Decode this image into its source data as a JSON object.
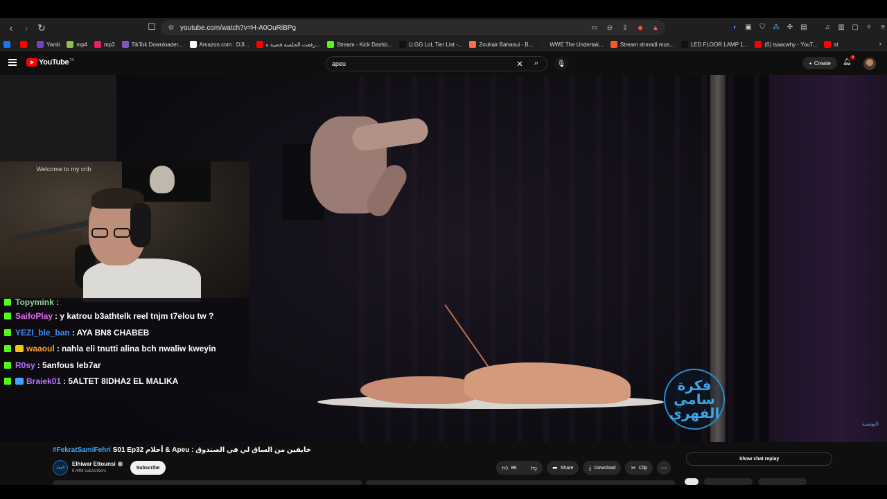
{
  "browser": {
    "url": "youtube.com/watch?v=H-A0OuRiBPg",
    "bookmarks": [
      {
        "label": "",
        "color": "#1877f2"
      },
      {
        "label": "",
        "color": "#ff0000"
      },
      {
        "label": "Yamli",
        "color": "#7b3fc4"
      },
      {
        "label": "mp4",
        "color": "#8bc34a"
      },
      {
        "label": "mp3",
        "color": "#e91e63"
      },
      {
        "label": "TikTok Downloader...",
        "color": "#7e57c2"
      },
      {
        "label": "Amazon.com : DJI...",
        "color": "#ffffff"
      },
      {
        "label": "رفعت الجلسة فضية ه...",
        "color": "#ff0000"
      },
      {
        "label": "Stream - Kick Dashb...",
        "color": "#53fc18"
      },
      {
        "label": "U.GG LoL Tier List -...",
        "color": "#111111"
      },
      {
        "label": "Zouhair Bahaoui - B...",
        "color": "#ff7043"
      },
      {
        "label": "WWE The Undertak...",
        "color": "#222222"
      },
      {
        "label": "Stream shmndl mus...",
        "color": "#ff5722"
      },
      {
        "label": "LED FLOOR LAMP 1...",
        "color": "#111111"
      },
      {
        "label": "(6) isaacwhy - YouT...",
        "color": "#ff0000"
      },
      {
        "label": "st",
        "color": "#ff0000"
      }
    ]
  },
  "youtube": {
    "logo_text": "YouTube",
    "logo_tm": "TN",
    "search_value": "apeu",
    "create_label": "Create",
    "notif_count": "9"
  },
  "webcam": {
    "sign_text": "Welcome to my crib"
  },
  "chat": {
    "partial_line": "Topymink :",
    "messages": [
      {
        "user": "SaifoPlay",
        "user_color": "#e46cf1",
        "text": ": y katrou b3athtelk reel tnjm t7elou tw ?",
        "badge": "#53fc18",
        "badge2": ""
      },
      {
        "user": "YEZI_ble_ban",
        "user_color": "#3d8cf5",
        "text": ": AYA BN8 CHABEB",
        "badge": "#53fc18",
        "badge2": ""
      },
      {
        "user": "waaoul",
        "user_color": "#f6a623",
        "text": ": nahla eli tnutti alina bch nwaliw kweyin",
        "badge": "#53fc18",
        "badge2": "#f5c518"
      },
      {
        "user": "R0sy",
        "user_color": "#b277f7",
        "text": ": 5anfous leb7ar",
        "badge": "#53fc18",
        "badge2": ""
      },
      {
        "user": "Braiek01",
        "user_color": "#b277f7",
        "text": ": 5ALTET 8IDHA2 EL MALIKA",
        "badge": "#53fc18",
        "badge2": "#3ea6ff"
      }
    ]
  },
  "video": {
    "watermark_text": "فكرة سامي الفهري",
    "channel_mark": "التونسية",
    "hashtag": "#FekratSamiFehri",
    "title_rest": " S01 Ep32 أحلام & Apeu : خايفين من الساق لي في الصندوق",
    "channel_name": "Elhiwar Ettounsi",
    "channel_avatar_label": "الحوار",
    "subscribers": "8.44M subscribers",
    "subscribe_label": "Subscribe",
    "likes": "8K",
    "share_label": "Share",
    "download_label": "Download",
    "clip_label": "Clip",
    "show_chat_label": "Show chat replay"
  }
}
